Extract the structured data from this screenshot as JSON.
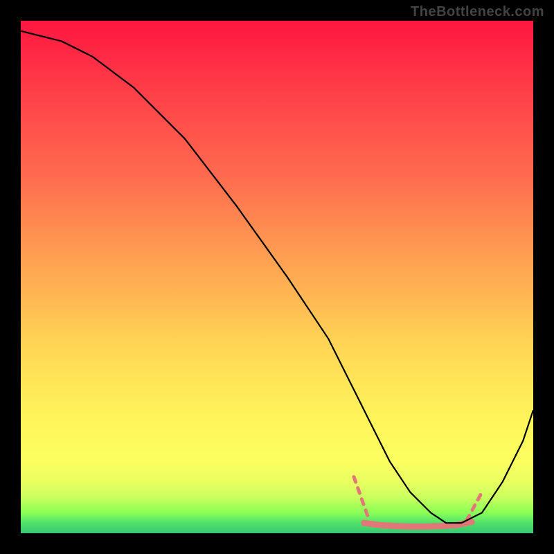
{
  "watermark": "TheBottleneck.com",
  "chart_data": {
    "type": "line",
    "title": "",
    "xlabel": "",
    "ylabel": "",
    "xlim": [
      0,
      100
    ],
    "ylim": [
      0,
      100
    ],
    "series": [
      {
        "name": "curve",
        "x": [
          0,
          4,
          8,
          14,
          22,
          32,
          42,
          52,
          60,
          65,
          68,
          72,
          76,
          80,
          83,
          86,
          90,
          94,
          98,
          100
        ],
        "y": [
          98,
          97,
          96,
          93,
          87,
          77,
          64,
          50,
          38,
          28,
          22,
          14,
          8,
          4,
          2,
          2,
          4,
          10,
          18,
          24
        ]
      },
      {
        "name": "emphasis-flat",
        "x": [
          67,
          70,
          73,
          76,
          79,
          82,
          85,
          88
        ],
        "y": [
          2.0,
          1.6,
          1.4,
          1.3,
          1.3,
          1.4,
          1.6,
          2.2
        ]
      }
    ],
    "annotations": [
      {
        "name": "emphasis-down-dash",
        "x0": 65,
        "y0": 11,
        "x1": 68,
        "y1": 2.5
      },
      {
        "name": "emphasis-up-dash",
        "x0": 87,
        "y0": 2.5,
        "x1": 90,
        "y1": 8
      }
    ],
    "colors": {
      "curve": "#000000",
      "emphasis": "#e07878",
      "gradient_top": "#ff163f",
      "gradient_bottom": "#39c973"
    }
  }
}
